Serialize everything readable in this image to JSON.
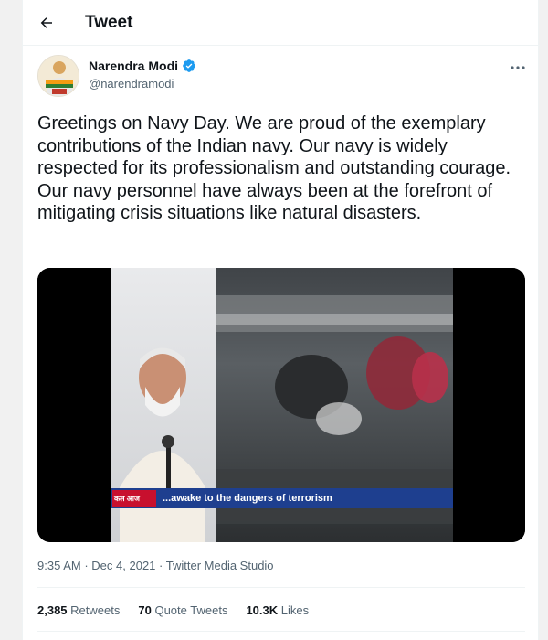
{
  "header": {
    "title": "Tweet",
    "back_icon": "arrow-left-icon"
  },
  "author": {
    "name": "Narendra Modi",
    "handle": "@narendramodi",
    "verified": true,
    "verified_color": "#1d9bf0",
    "avatar_icon": "profile-avatar"
  },
  "tweet": {
    "text": "Greetings on Navy Day. We are proud of the exemplary contributions of the Indian navy. Our navy is widely respected for its professionalism and outstanding courage. Our navy personnel have always been at the forefront of mitigating crisis situations like natural disasters.",
    "media": {
      "caption": "...awake to the dangers of terrorism",
      "ticker_tag": "कल आज"
    },
    "time": "9:35 AM",
    "date": "Dec 4, 2021",
    "source": "Twitter Media Studio"
  },
  "stats": {
    "retweets_count": "2,385",
    "retweets_label": "Retweets",
    "quotes_count": "70",
    "quotes_label": "Quote Tweets",
    "likes_count": "10.3K",
    "likes_label": "Likes"
  },
  "colors": {
    "text_primary": "#0f1419",
    "text_secondary": "#536471",
    "border": "#eff3f4",
    "ticker_blue": "#1e3f8f",
    "ticker_red": "#c8102e"
  }
}
